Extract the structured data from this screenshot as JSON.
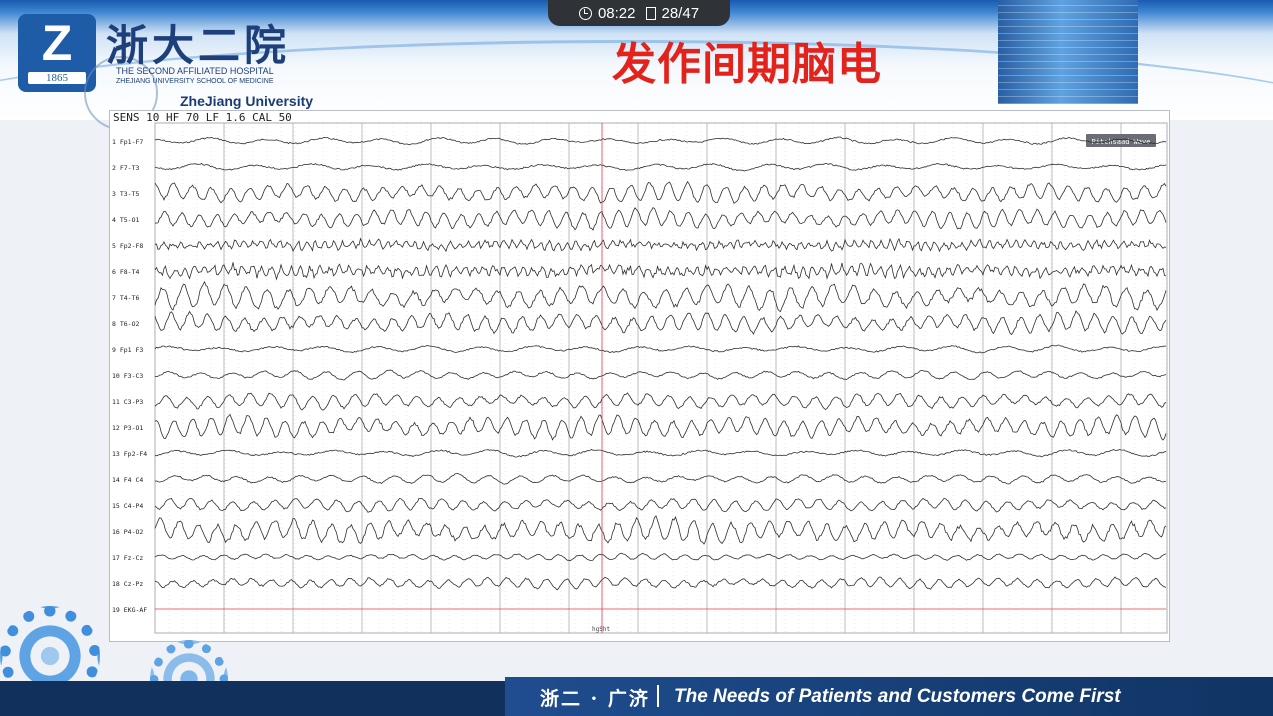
{
  "status_bar": {
    "time": "08:22",
    "page": "28/47"
  },
  "logo": {
    "mark_letter": "Z",
    "year": "1865",
    "chinese_name": "浙大二院",
    "english_line1": "THE SECOND AFFILIATED HOSPITAL",
    "english_line2": "ZHEJIANG UNIVERSITY SCHOOL OF MEDICINE",
    "university": "ZheJiang University"
  },
  "slide": {
    "title": "发作间期脑电"
  },
  "eeg": {
    "settings": "SENS 10  HF 70  LF 1.6  CAL 50",
    "button": "Pitchsaad Wave",
    "bottom_label": "hgSht",
    "channels": [
      {
        "num": "1",
        "name": "Fp1-F7",
        "amp": 3,
        "freq": 0.11,
        "noise": 0.4
      },
      {
        "num": "2",
        "name": "F7-T3",
        "amp": 3,
        "freq": 0.11,
        "noise": 0.4
      },
      {
        "num": "3",
        "name": "T3-T5",
        "amp": 9,
        "freq": 0.33,
        "noise": 0.25
      },
      {
        "num": "4",
        "name": "T5-O1",
        "amp": 9,
        "freq": 0.36,
        "noise": 0.25
      },
      {
        "num": "5",
        "name": "Fp2-F8",
        "amp": 4,
        "freq": 0.7,
        "noise": 1.0
      },
      {
        "num": "6",
        "name": "F8-T4",
        "amp": 5,
        "freq": 0.65,
        "noise": 1.0
      },
      {
        "num": "7",
        "name": "T4-T6",
        "amp": 11,
        "freq": 0.3,
        "noise": 0.3
      },
      {
        "num": "8",
        "name": "T6-O2",
        "amp": 9,
        "freq": 0.34,
        "noise": 0.3
      },
      {
        "num": "9",
        "name": "Fp1 F3",
        "amp": 3,
        "freq": 0.12,
        "noise": 0.4
      },
      {
        "num": "10",
        "name": "F3-C3",
        "amp": 4,
        "freq": 0.2,
        "noise": 0.3
      },
      {
        "num": "11",
        "name": "C3-P3",
        "amp": 7,
        "freq": 0.3,
        "noise": 0.25
      },
      {
        "num": "12",
        "name": "P3-O1",
        "amp": 10,
        "freq": 0.34,
        "noise": 0.25
      },
      {
        "num": "13",
        "name": "Fp2-F4",
        "amp": 3,
        "freq": 0.12,
        "noise": 0.4
      },
      {
        "num": "14",
        "name": "F4 C4",
        "amp": 4,
        "freq": 0.2,
        "noise": 0.3
      },
      {
        "num": "15",
        "name": "C4-P4",
        "amp": 6,
        "freq": 0.3,
        "noise": 0.25
      },
      {
        "num": "16",
        "name": "P4-O2",
        "amp": 11,
        "freq": 0.33,
        "noise": 0.3
      },
      {
        "num": "17",
        "name": "Fz-Cz",
        "amp": 3,
        "freq": 0.3,
        "noise": 0.3
      },
      {
        "num": "18",
        "name": "Cz-Pz",
        "amp": 5,
        "freq": 0.32,
        "noise": 0.3
      },
      {
        "num": "19",
        "name": "EKG-AF",
        "amp": 0,
        "freq": 0,
        "noise": 0,
        "color": "#e23c3c"
      }
    ],
    "grid_color": "#c6c9ce",
    "trace_color": "#2e2e2e",
    "marker_color": "#e2394a"
  },
  "footer": {
    "chinese": "浙二 · 广济",
    "slogan": "The Needs of Patients and Customers Come First"
  }
}
